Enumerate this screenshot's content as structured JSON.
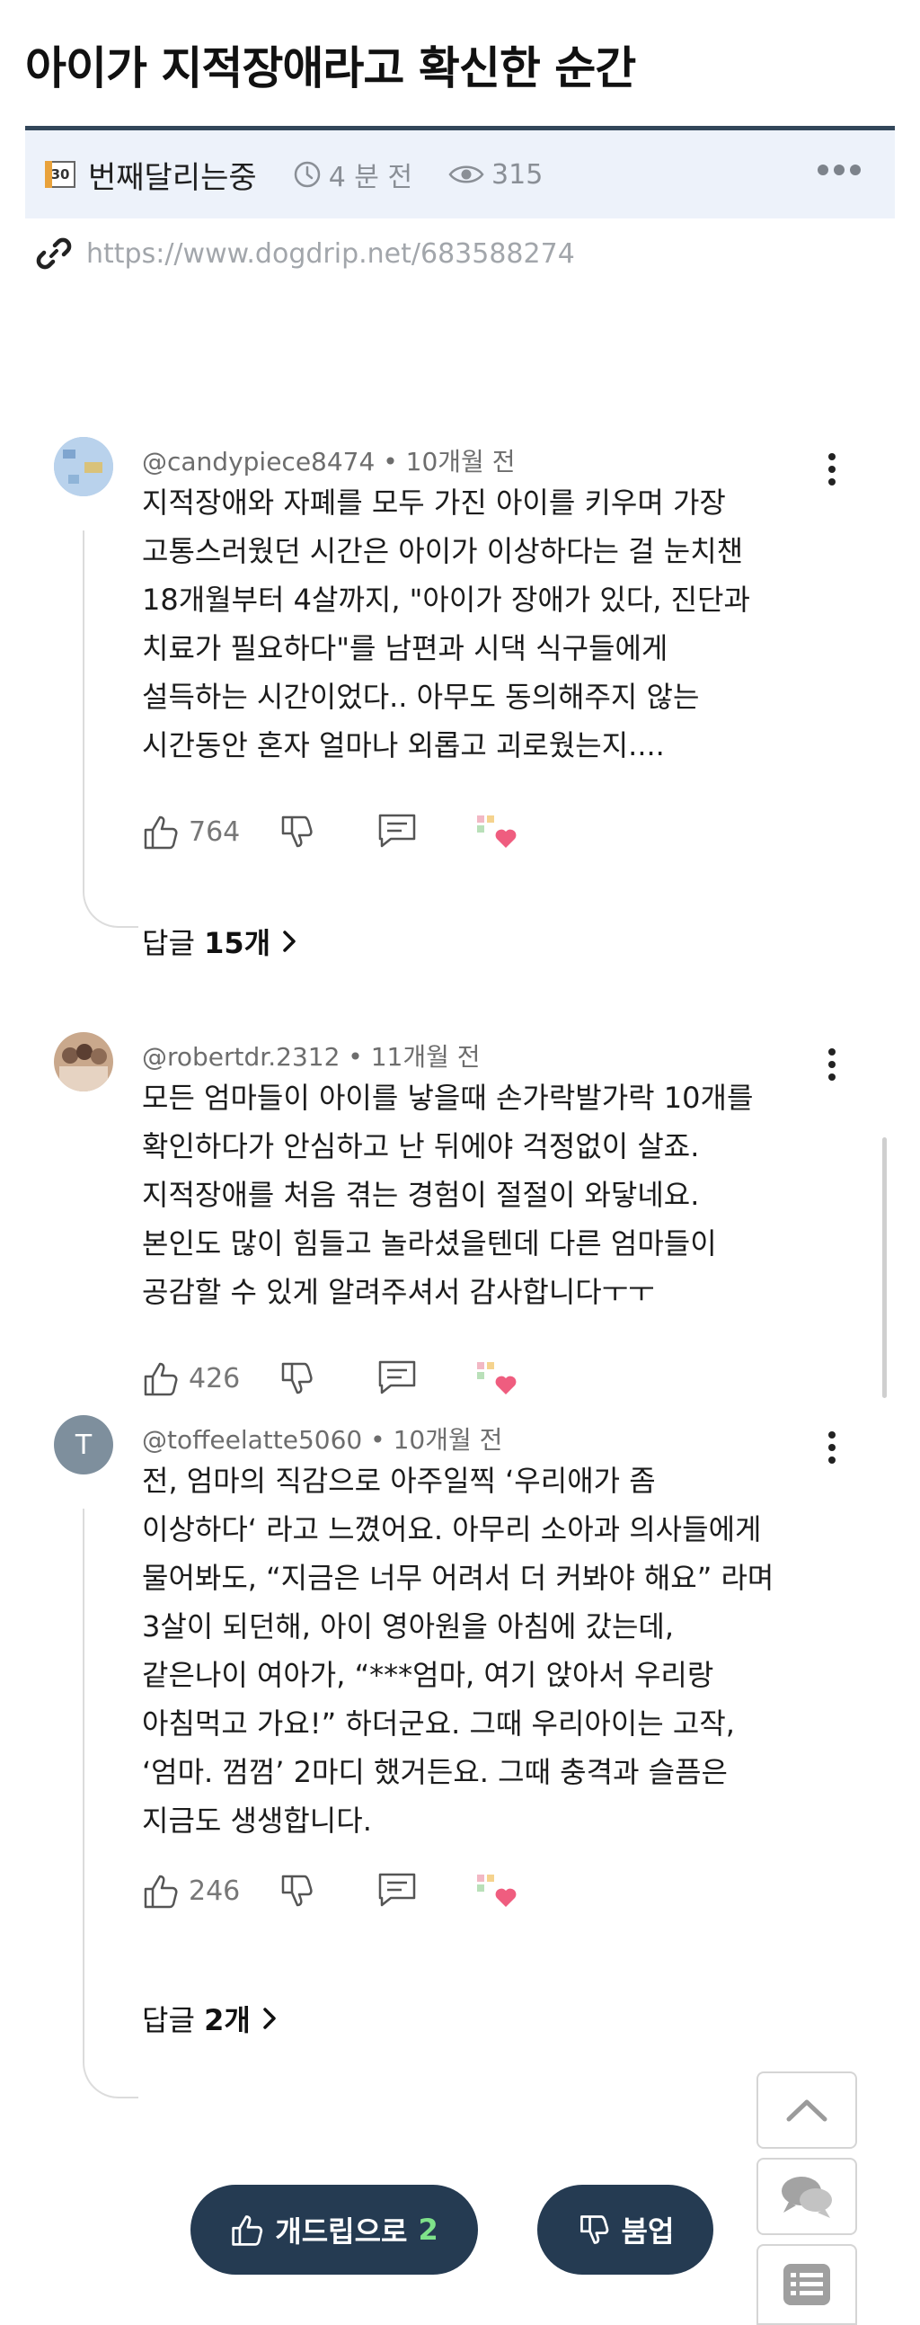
{
  "post": {
    "title": "아이가 지적장애라고 확신한 순간",
    "level_badge": "30",
    "author": "번째달리는중",
    "time": "4 분 전",
    "views": "315",
    "url": "https://www.dogdrip.net/683588274"
  },
  "comments": [
    {
      "handle": "@candypiece8474",
      "time": "10개월 전",
      "text": "지적장애와 자폐를 모두 가진 아이를 키우며 가장\n고통스러웠던 시간은 아이가 이상하다는 걸 눈치챈\n18개월부터 4살까지, \"아이가 장애가 있다, 진단과\n치료가 필요하다\"를 남편과 시댁 식구들에게\n설득하는 시간이었다.. 아무도 동의해주지 않는\n시간동안 혼자 얼마나 외롭고 괴로웠는지....",
      "likes": "764",
      "reply_label": "답글",
      "reply_count": "15개"
    },
    {
      "handle": "@robertdr.2312",
      "time": "11개월 전",
      "text": "모든 엄마들이 아이를 낳을때 손가락발가락 10개를\n확인하다가 안심하고 난 뒤에야 걱정없이 살죠.\n지적장애를 처음 겪는 경험이 절절이 와닿네요.\n본인도 많이 힘들고 놀라셨을텐데 다른 엄마들이\n공감할 수 있게 알려주셔서 감사합니다ㅜㅜ",
      "likes": "426"
    },
    {
      "avatar_letter": "T",
      "handle": "@toffeelatte5060",
      "time": "10개월 전",
      "text": "전, 엄마의 직감으로 아주일찍 ‘우리애가 좀\n이상하다‘ 라고 느꼈어요. 아무리 소아과 의사들에게\n물어봐도, “지금은 너무 어려서 더 커봐야 해요” 라며\n3살이 되던해, 아이 영아원을 아침에 갔는데,\n같은나이 여아가, “***엄마, 여기 앉아서 우리랑\n아침먹고 가요!” 하더군요. 그때 우리아이는 고작,\n‘엄마. 껌껌’ 2마디 했거든요. 그때 충격과 슬픔은\n지금도 생생합니다.",
      "likes": "246",
      "reply_label": "답글",
      "reply_count": "2개"
    }
  ],
  "bottom": {
    "upvote_label": "개드립으로",
    "upvote_count": "2",
    "downvote_label": "붐업"
  },
  "colors": {
    "navy": "#253b52",
    "green_count": "#7fe28a",
    "meta_bg": "#edf2fa"
  }
}
